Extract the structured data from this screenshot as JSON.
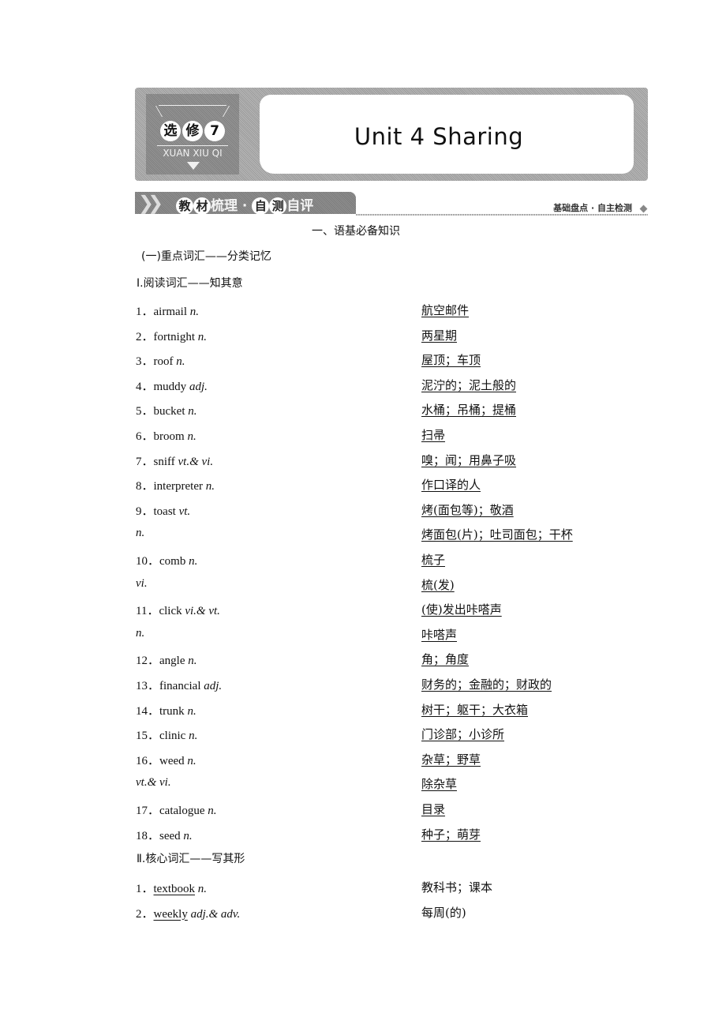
{
  "banner": {
    "badge_chars": [
      "选",
      "修",
      "7"
    ],
    "badge_pinyin": "XUAN XIU QI",
    "title": "Unit 4  Sharing",
    "icon": "book-search-icon"
  },
  "section_bar": {
    "tab_circled_1": "教",
    "tab_circled_2": "材",
    "tab_text_1": "梳理",
    "tab_sep": "·",
    "tab_circled_3": "自",
    "tab_circled_4": "测",
    "tab_text_2": "自评",
    "right_label": "基础盘点 · 自主检测"
  },
  "headings": {
    "main": "一、语基必备知识",
    "sub": "(一)重点词汇——分类记忆",
    "part1": "Ⅰ.阅读词汇——知其意",
    "part2": "Ⅱ.核心词汇——写其形"
  },
  "reading_vocab": [
    {
      "num": "1．",
      "word": "airmail",
      "pos": "n.",
      "meaning": "航空邮件"
    },
    {
      "num": "2．",
      "word": "fortnight",
      "pos": "n.",
      "meaning": "两星期"
    },
    {
      "num": "3．",
      "word": "roof",
      "pos": "n.",
      "meaning": "屋顶；车顶"
    },
    {
      "num": "4．",
      "word": "muddy",
      "pos": "adj.",
      "meaning": "泥泞的；泥土般的"
    },
    {
      "num": "5．",
      "word": "bucket",
      "pos": "n.",
      "meaning": "水桶；吊桶；提桶"
    },
    {
      "num": "6．",
      "word": "broom",
      "pos": "n.",
      "meaning": "扫帚"
    },
    {
      "num": "7．",
      "word": "sniff",
      "pos": "vt.& vi.",
      "meaning": "嗅；闻；用鼻子吸"
    },
    {
      "num": "8．",
      "word": "interpreter",
      "pos": "n.",
      "meaning": "作口译的人"
    },
    {
      "num": "9．",
      "word": "toast",
      "pos": "vt.",
      "meaning": "烤(面包等)；敬酒"
    },
    {
      "num": "",
      "word": "",
      "pos": "n.",
      "meaning": "烤面包(片)；吐司面包；干杯"
    },
    {
      "num": "10．",
      "word": "comb",
      "pos": "n.",
      "meaning": "梳子"
    },
    {
      "num": "",
      "word": "",
      "pos": "vi.",
      "meaning": "梳(发)"
    },
    {
      "num": "11．",
      "word": "click",
      "pos": "vi.& vt.",
      "meaning": "(使)发出咔嗒声"
    },
    {
      "num": "",
      "word": "",
      "pos": "n.",
      "meaning": "咔嗒声"
    },
    {
      "num": "12．",
      "word": "angle",
      "pos": "n.",
      "meaning": "角；角度"
    },
    {
      "num": "13．",
      "word": "financial",
      "pos": "adj.",
      "meaning": "财务的；金融的；财政的"
    },
    {
      "num": "14．",
      "word": "trunk",
      "pos": "n.",
      "meaning": "树干；躯干；大衣箱"
    },
    {
      "num": "15．",
      "word": "clinic",
      "pos": "n.",
      "meaning": "门诊部；小诊所"
    },
    {
      "num": "16．",
      "word": "weed",
      "pos": "n.",
      "meaning": "杂草；野草"
    },
    {
      "num": "",
      "word": "",
      "pos": "vt.& vi.",
      "meaning": "除杂草"
    },
    {
      "num": "17．",
      "word": "catalogue",
      "pos": "n.",
      "meaning": "目录"
    },
    {
      "num": "18．",
      "word": "seed",
      "pos": "n.",
      "meaning": "种子；萌芽"
    }
  ],
  "core_vocab": [
    {
      "num": "1．",
      "word": "textbook",
      "pos": "n.",
      "meaning": "教科书；课本"
    },
    {
      "num": "2．",
      "word": "weekly",
      "pos": "adj.& adv.",
      "meaning": "每周(的)"
    }
  ]
}
